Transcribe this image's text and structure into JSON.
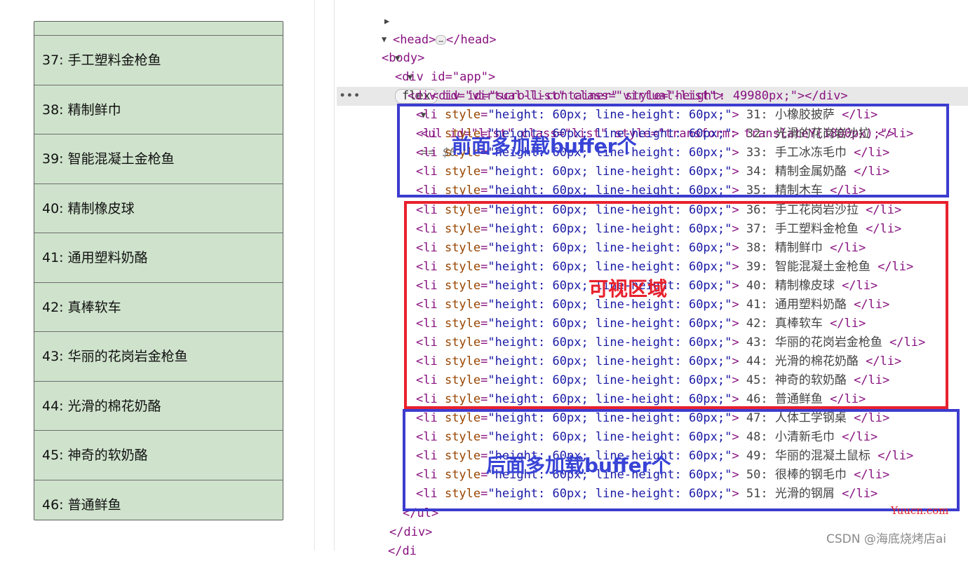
{
  "viewport": {
    "items": [
      "37: 手工塑料金枪鱼",
      "38: 精制鲜巾",
      "39: 智能混凝土金枪鱼",
      "40: 精制橡皮球",
      "41: 通用塑料奶酪",
      "42: 真棒软车",
      "43: 华丽的花岗岩金枪鱼",
      "44: 光滑的棉花奶酪",
      "45: 神奇的软奶酪",
      "46: 普通鲜鱼"
    ]
  },
  "devtools": {
    "head_open": "<head>",
    "head_close": "</head>",
    "ellipsis": "…",
    "body_open": "<body>",
    "app_div": "<div id=\"app\">",
    "flex_badge": "flex",
    "virtual_list_div": "<div id=\"virtual-list\" class=\"virtual-list\">",
    "scroll_container": "<div id=\"scroll-container\" style=\"height: 49980px;\"></div>",
    "ul_open": "<ul id=\"list\" class=\"list\" style=\"transform: translateY(1800px);\">",
    "selected_marker": "== $0",
    "row_dots": "•••",
    "li_open": "<li style=\"height: 60px; line-height: 60px;\">",
    "li_close": "</li>",
    "li_items": [
      " 31: 小橡胶披萨 ",
      " 32: 光滑的花岗岩沙拉 ",
      " 33: 手工冰冻毛巾 ",
      " 34: 精制金属奶酪 ",
      " 35: 精制木车 ",
      " 36: 手工花岗岩沙拉 ",
      " 37: 手工塑料金枪鱼 ",
      " 38: 精制鲜巾 ",
      " 39: 智能混凝土金枪鱼 ",
      " 40: 精制橡皮球 ",
      " 41: 通用塑料奶酪 ",
      " 42: 真棒软车 ",
      " 43: 华丽的花岗岩金枪鱼 ",
      " 44: 光滑的棉花奶酪 ",
      " 45: 神奇的软奶酪 ",
      " 46: 普通鲜鱼 ",
      " 47: 人体工学钢桌 ",
      " 48: 小清新毛巾 ",
      " 49: 华丽的混凝土鼠标 ",
      " 50: 很棒的钢毛巾 ",
      " 51: 光滑的钢屑 "
    ],
    "ul_close": "</ul>",
    "div_close": "</div>",
    "div_close_partial": "</di"
  },
  "annotations": {
    "top_buffer": "前面多加载buffer个",
    "visible_area": "可视区域",
    "bottom_buffer": "后面多加载buffer个",
    "blue": "#3c3ccf",
    "red": "#e8212d"
  },
  "watermarks": {
    "site": "Yuucn.com",
    "author": "CSDN @海底烧烤店ai"
  }
}
